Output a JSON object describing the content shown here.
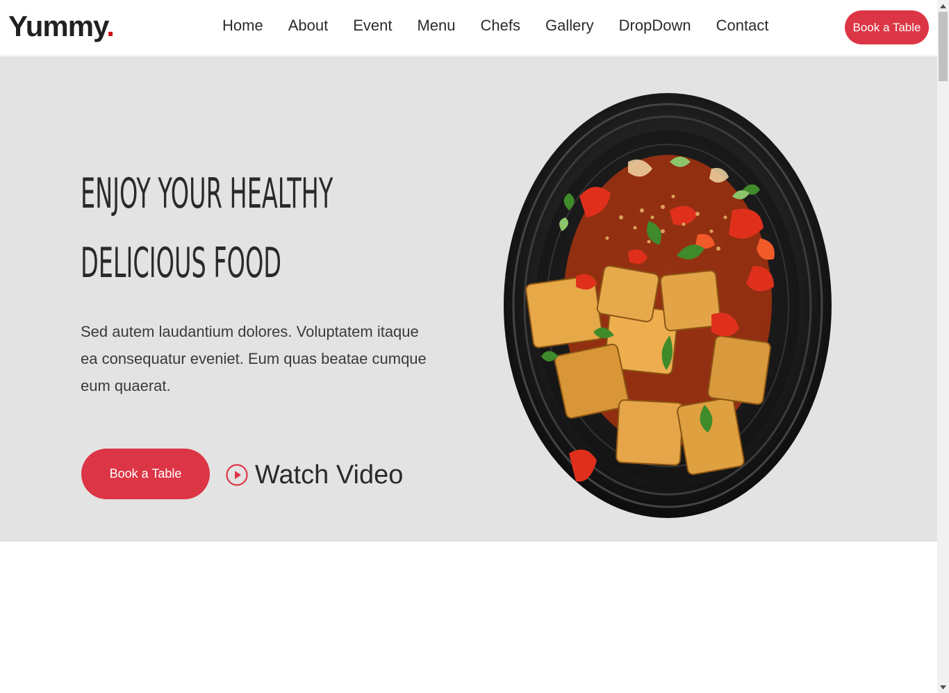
{
  "header": {
    "logo_text": "Yummy",
    "logo_dot": ".",
    "nav": [
      "Home",
      "About",
      "Event",
      "Menu",
      "Chefs",
      "Gallery",
      "DropDown",
      "Contact"
    ],
    "cta_label": "Book a Table"
  },
  "hero": {
    "title": "Enjoy Your Healthy Delicious Food",
    "text": "Sed autem laudantium dolores. Voluptatem itaque ea consequatur eveniet. Eum quas beatae cumque eum quaerat.",
    "book_label": "Book a Table",
    "watch_label": "Watch Video"
  },
  "colors": {
    "accent": "#dc3545",
    "hero_bg": "#e3e3e3"
  },
  "icons": {
    "play": "play-circle-icon",
    "scroll_up": "triangle-up-icon",
    "scroll_down": "triangle-down-icon"
  }
}
